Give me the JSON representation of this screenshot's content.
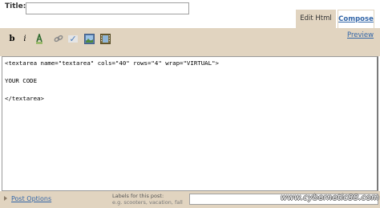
{
  "title_field": {
    "label": "Title:",
    "value": ""
  },
  "tabs": [
    {
      "label": "Edit Html",
      "active": true
    },
    {
      "label": "Compose",
      "active": false
    }
  ],
  "toolbar": {
    "bold_label": "b",
    "italic_label": "i",
    "icons": [
      "text-color-icon",
      "link-icon",
      "blockquote-icon",
      "spellcheck-icon",
      "image-icon",
      "video-icon"
    ],
    "preview_label": "Preview"
  },
  "editor": {
    "content": "<textarea name=\"textarea\" cols=\"40\" rows=\"4\" wrap=\"VIRTUAL\">\n\nYOUR CODE\n\n</textarea>"
  },
  "bottom": {
    "post_options_label": "Post Options",
    "labels_title": "Labels for this post:",
    "labels_example": "e.g. scooters, vacation, fall",
    "labels_value": ""
  },
  "watermark": "www.cybernetic88.com",
  "colors": {
    "toolbar_bg": "#e1d4c0",
    "link": "#3366a8"
  }
}
